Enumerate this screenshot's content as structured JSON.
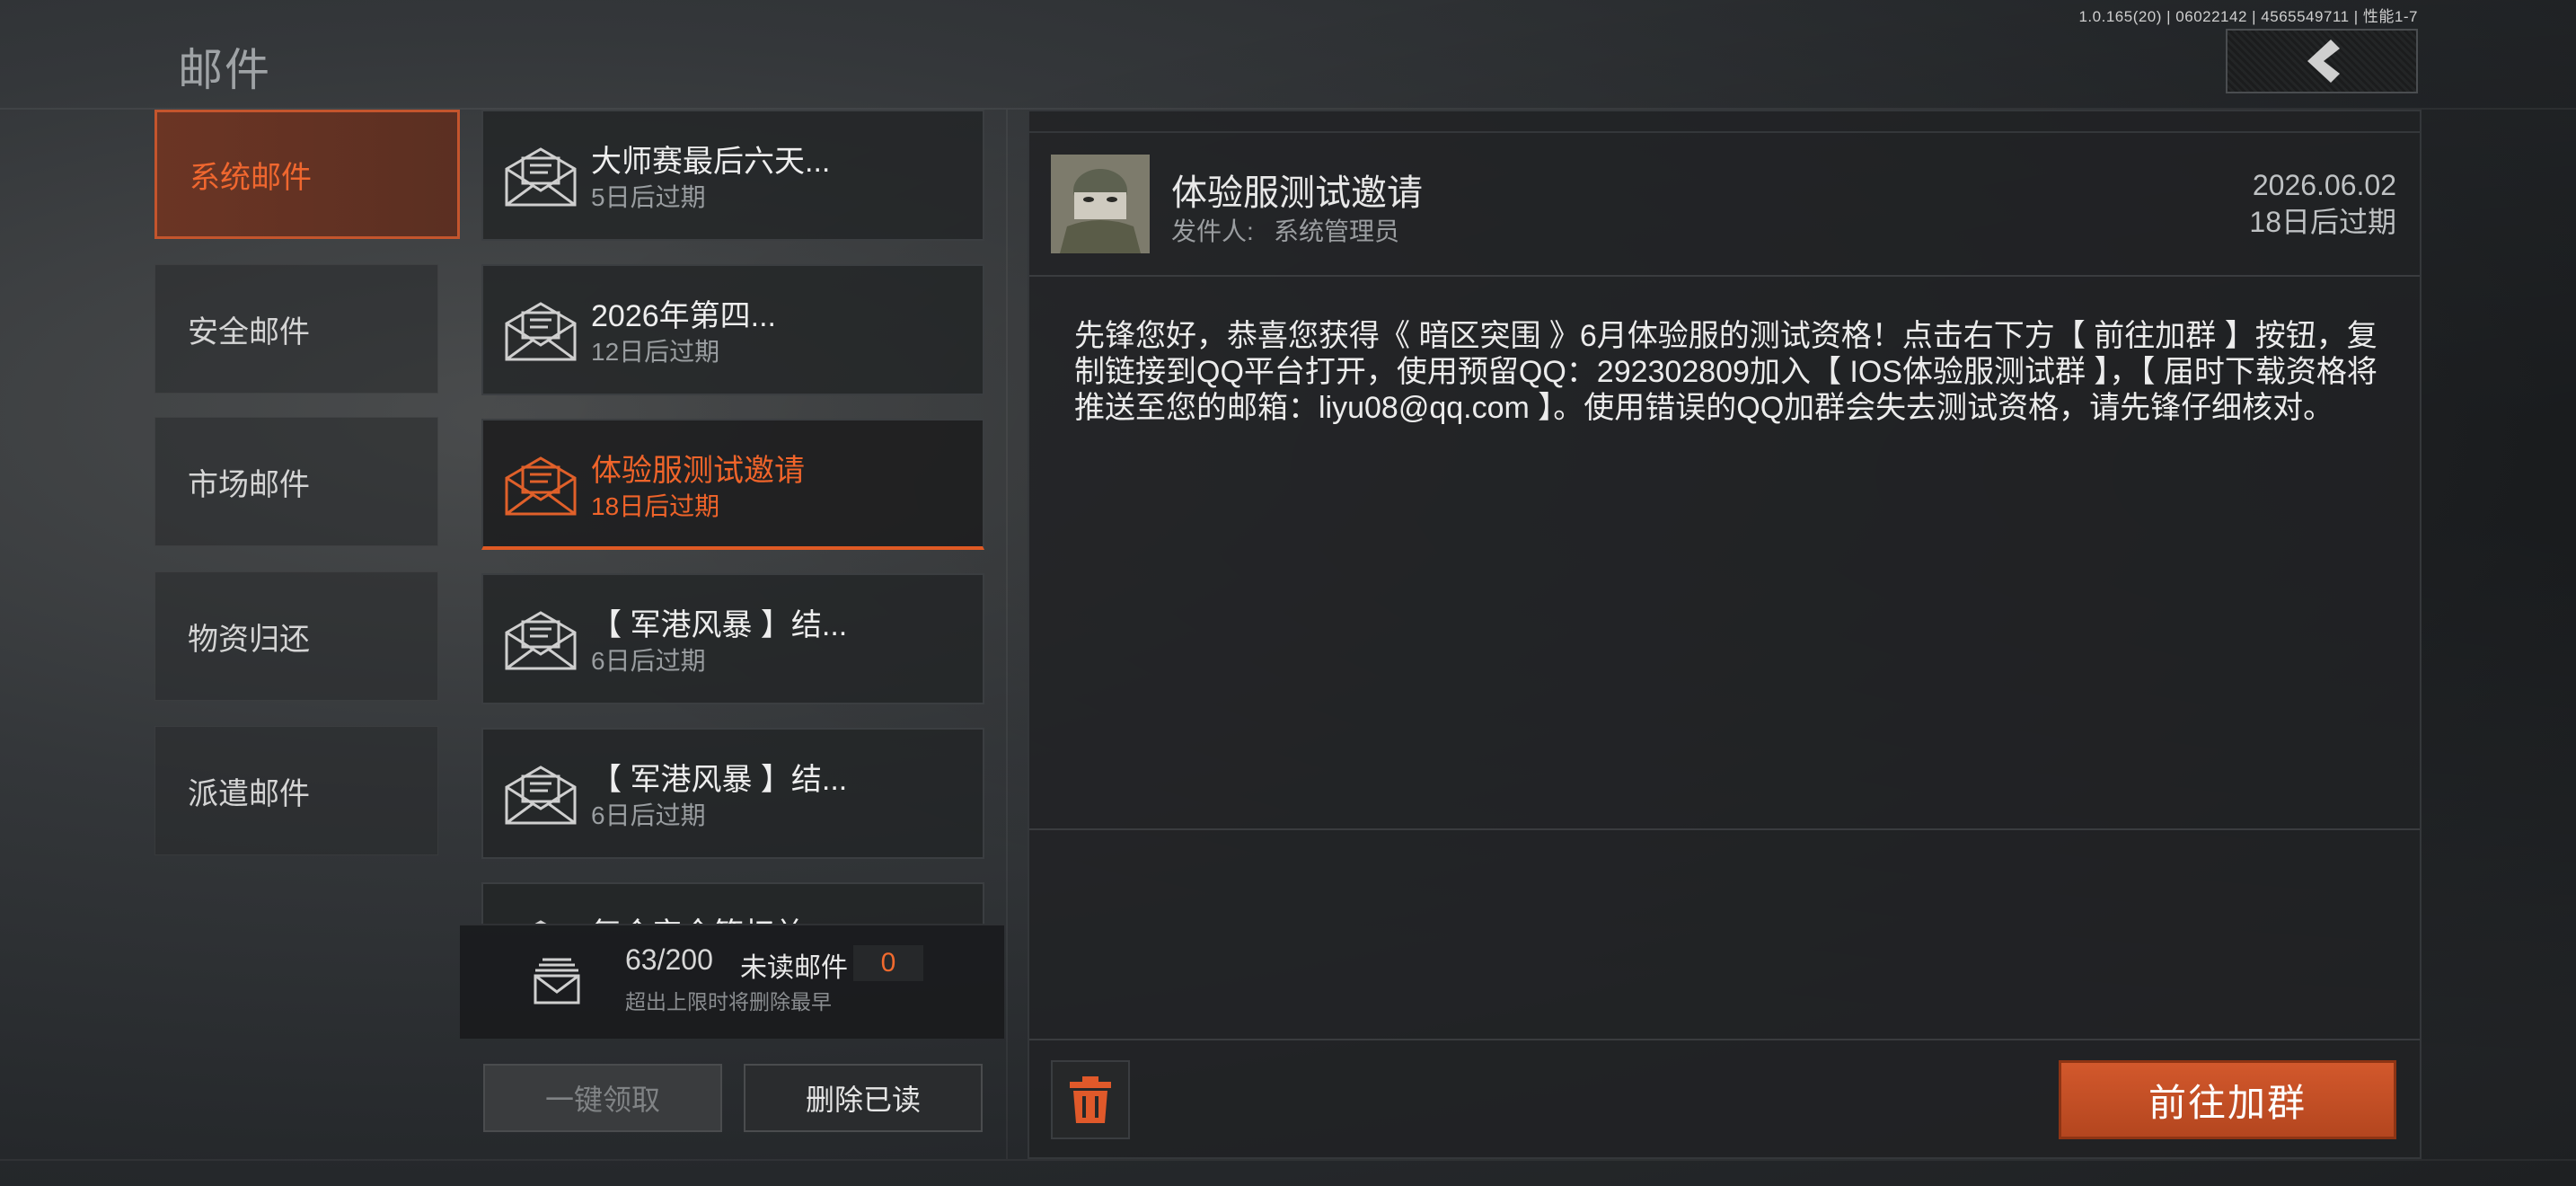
{
  "version_text": "1.0.165(20) | 06022142 | 4565549711 | 性能1-7",
  "page_title": "邮件",
  "categories": [
    {
      "label": "系统邮件",
      "active": true
    },
    {
      "label": "安全邮件",
      "active": false
    },
    {
      "label": "市场邮件",
      "active": false
    },
    {
      "label": "物资归还",
      "active": false
    },
    {
      "label": "派遣邮件",
      "active": false
    }
  ],
  "mails": [
    {
      "subject": "大师赛最后六天...",
      "expire": "5日后过期",
      "active": false
    },
    {
      "subject": "2026年第四...",
      "expire": "12日后过期",
      "active": false
    },
    {
      "subject": "体验服测试邀请",
      "expire": "18日后过期",
      "active": true
    },
    {
      "subject": "【 军港风暴 】结...",
      "expire": "6日后过期",
      "active": false
    },
    {
      "subject": "【 军港风暴 】结...",
      "expire": "6日后过期",
      "active": false
    },
    {
      "subject": "复合安全箱权益...",
      "expire": "",
      "active": false
    }
  ],
  "footer": {
    "count": "63/200",
    "unread_label": "未读邮件",
    "unread_count": "0",
    "limit_note": "超出上限时将删除最早"
  },
  "buttons": {
    "claim_all": "一键领取",
    "delete_read": "删除已读",
    "join_group": "前往加群"
  },
  "detail": {
    "title": "体验服测试邀请",
    "sender_label": "发件人:",
    "sender_name": "系统管理员",
    "date": "2026.06.02",
    "expire": "18日后过期",
    "body": "先锋您好，恭喜您获得《 暗区突围 》6月体验服的测试资格！点击右下方【 前往加群 】按钮，复制链接到QQ平台打开，使用预留QQ：292302809加入【 IOS体验服测试群 】，【 届时下载资格将推送至您的邮箱：liyu08@qq.com 】。使用错误的QQ加群会失去测试资格，请先锋仔细核对。"
  },
  "icons": {
    "back": "chevron-left-icon",
    "envelope": "envelope-icon",
    "mail_stack": "mail-stack-icon",
    "trash": "trash-icon"
  },
  "colors": {
    "accent": "#f0642a",
    "button_primary": "#c4502a"
  }
}
